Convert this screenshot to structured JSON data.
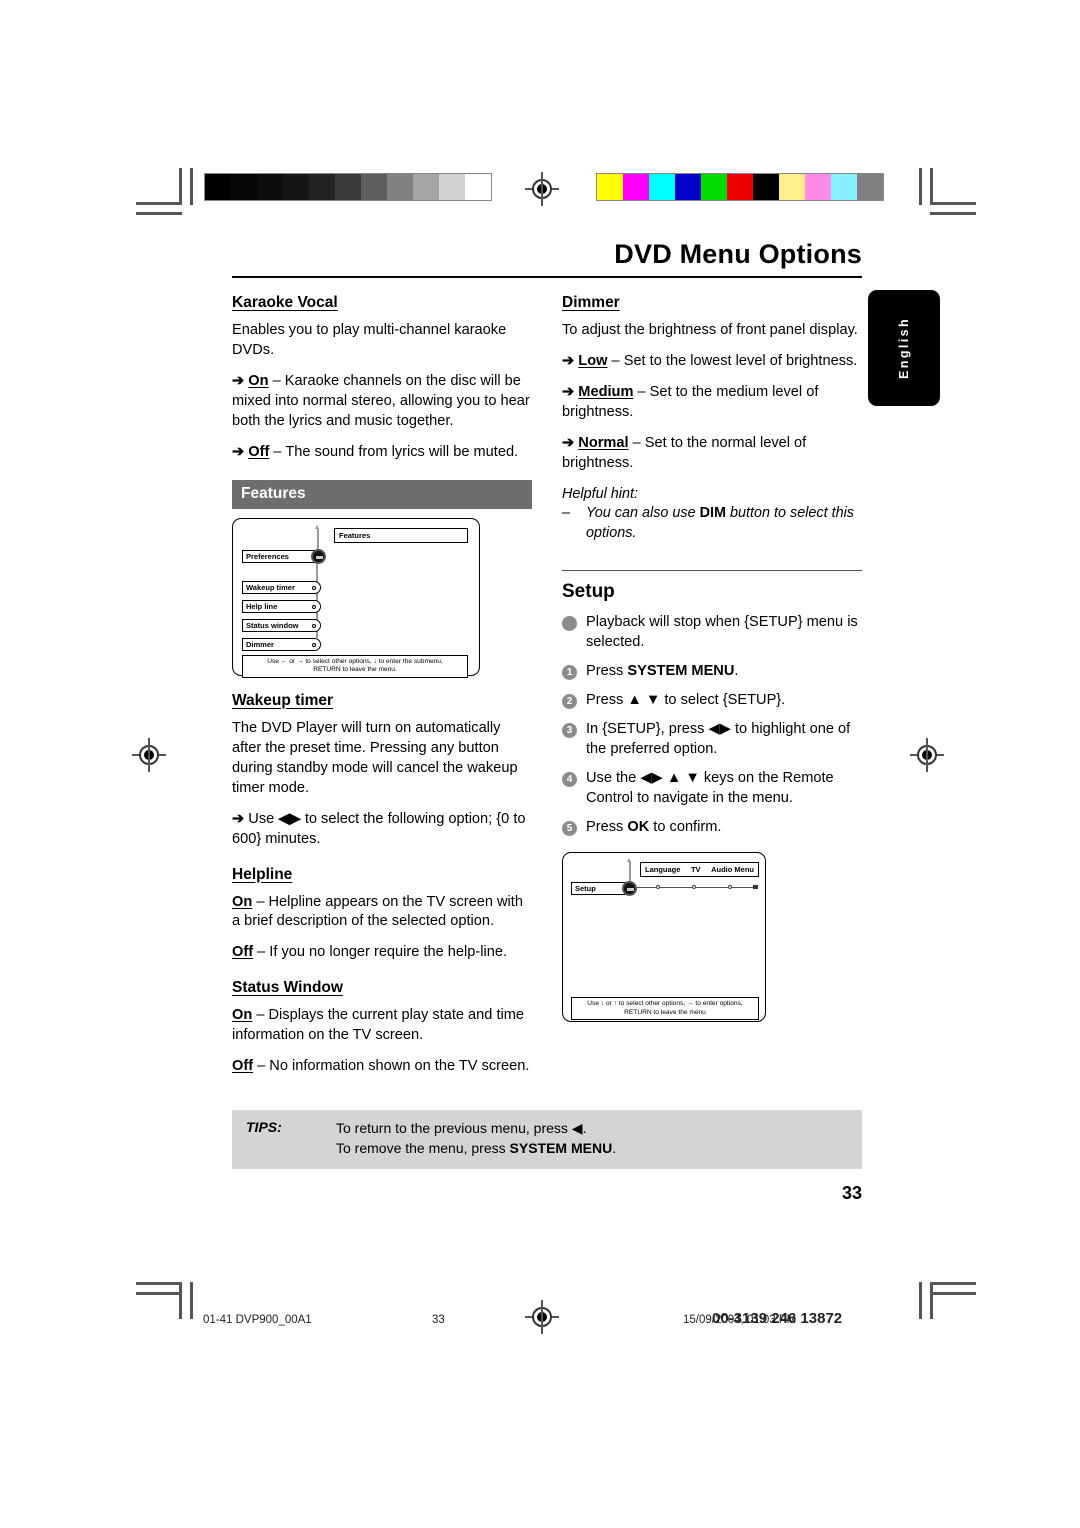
{
  "header": {
    "title": "DVD Menu Options",
    "language_tab": "English"
  },
  "left_column": {
    "karaoke": {
      "heading": "Karaoke Vocal",
      "intro": "Enables you to play multi-channel karaoke DVDs.",
      "options": [
        {
          "arrow": "➔",
          "label": "On",
          "text": " – Karaoke channels on the disc will be mixed into normal stereo, allowing you to hear both the lyrics and music together."
        },
        {
          "arrow": "➔",
          "label": "Off",
          "text": " – The sound from lyrics will be muted."
        }
      ]
    },
    "features_bar": "Features",
    "features_osd": {
      "title": "Features",
      "selected_item": "Preferences",
      "items": [
        "Wakeup timer",
        "Help line",
        "Status window",
        "Dimmer"
      ],
      "footer_line1": "Use ← or → to select other options, ↓ to enter the submenu,",
      "footer_line2": "RETURN to leave the menu."
    },
    "wakeup": {
      "heading": "Wakeup timer",
      "text": "The DVD Player will turn on automatically after the preset time. Pressing any button during standby mode will cancel the wakeup timer mode.",
      "option": {
        "arrow": "➔",
        "pre": "Use ",
        "keys": "◀▶",
        "post": " to select the following option; {0 to 600} minutes."
      }
    },
    "helpline": {
      "heading": "Helpline",
      "options": [
        {
          "label": "On",
          "text": " – Helpline appears on the TV screen with a brief description of the selected option."
        },
        {
          "label": "Off",
          "text": " – If you no longer require the help-line."
        }
      ]
    },
    "status_window": {
      "heading": "Status Window",
      "options": [
        {
          "label": "On",
          "text": " – Displays the current play state and time information on the TV screen."
        },
        {
          "label": "Off",
          "text": " – No information shown on the TV screen."
        }
      ]
    }
  },
  "right_column": {
    "dimmer": {
      "heading": "Dimmer",
      "intro": "To adjust the brightness of front panel display.",
      "options": [
        {
          "arrow": "➔",
          "label": "Low",
          "text": " – Set to the lowest level of brightness."
        },
        {
          "arrow": "➔",
          "label": "Medium",
          "text": " – Set to the medium level of brightness."
        },
        {
          "arrow": "➔",
          "label": "Normal",
          "text": " – Set to the normal level of brightness."
        }
      ],
      "hint_title": "Helpful hint:",
      "hint_dash": "–",
      "hint_pre": "You can also use ",
      "hint_bold": "DIM",
      "hint_post": " button to select this options."
    },
    "setup": {
      "heading": "Setup",
      "note_bullet": "●",
      "note": "Playback will stop when {SETUP} menu is selected.",
      "steps": [
        {
          "num": "1",
          "pre": "Press ",
          "bold": "SYSTEM MENU",
          "post": "."
        },
        {
          "num": "2",
          "pre": "Press ",
          "keys": "▲ ▼",
          "post": " to select {SETUP}."
        },
        {
          "num": "3",
          "pre": "In {SETUP}, press ",
          "keys": "◀▶",
          "post": " to highlight one of the preferred option."
        },
        {
          "num": "4",
          "pre": "Use the ",
          "keys": "◀▶ ▲ ▼",
          "post": " keys on the Remote Control to navigate in the menu."
        },
        {
          "num": "5",
          "pre": "Press ",
          "bold": "OK",
          "post": " to confirm."
        }
      ],
      "osd": {
        "selected_item": "Setup",
        "tabs": [
          "Language",
          "TV",
          "Audio Menu"
        ],
        "footer_line1": "Use ↓ or ↑ to select other options, → to enter options,",
        "footer_line2": "RETURN to leave the menu"
      }
    }
  },
  "tips": {
    "label": "TIPS:",
    "line1_pre": "To return to the previous menu, press ",
    "line1_key": "◀",
    "line1_post": ".",
    "line2_pre": "To remove the menu, press ",
    "line2_bold": "SYSTEM MENU",
    "line2_post": "."
  },
  "page_number": "33",
  "print_footer": {
    "left": "01-41 DVP900_00A1",
    "center": "33",
    "date": "15/09/2004, 01:03 PM",
    "partno": "00-3139 246 13872"
  },
  "calibration": {
    "grayscale": [
      "#000000",
      "#060606",
      "#0d0d0d",
      "#161616",
      "#232323",
      "#3b3b3b",
      "#5e5e5e",
      "#818181",
      "#a5a5a5",
      "#d0d0d0",
      "#ffffff"
    ],
    "colors": [
      "#ffff00",
      "#ff00ff",
      "#00ffff",
      "#0000cc",
      "#00dd00",
      "#ee0000",
      "#000000",
      "#ffef8a",
      "#ff8ae8",
      "#8af2ff",
      "#808080"
    ]
  }
}
